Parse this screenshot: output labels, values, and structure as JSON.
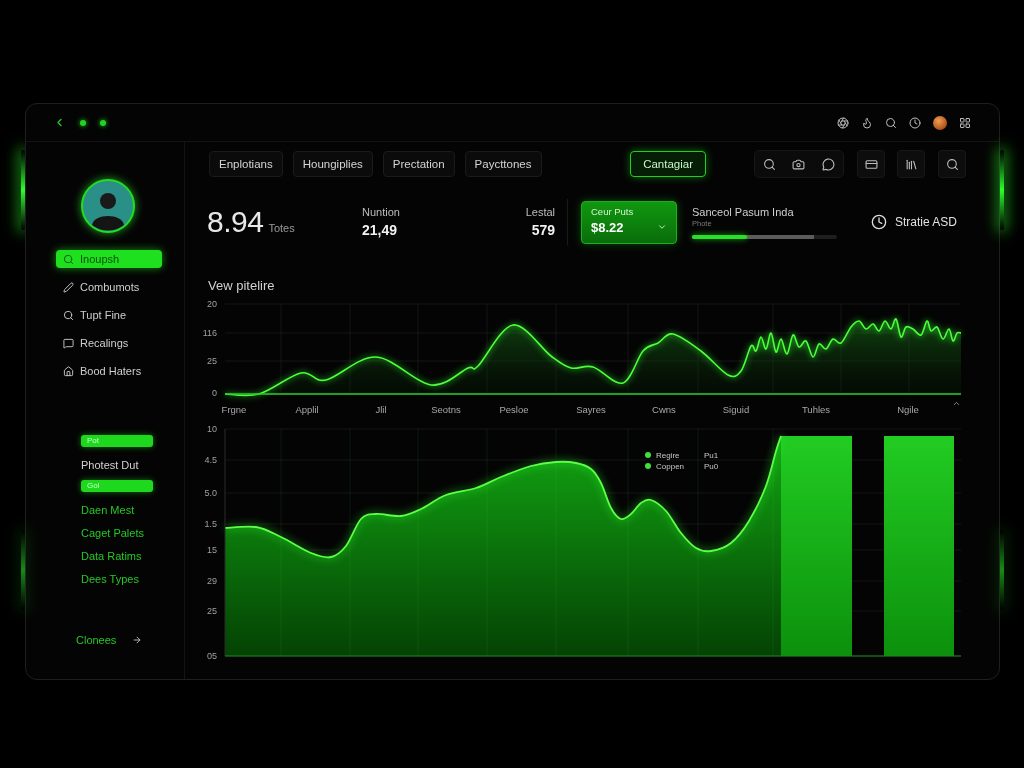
{
  "sidebar": {
    "nav_items": [
      {
        "label": "Inoupsh",
        "selected": true
      },
      {
        "label": "Combumots",
        "selected": false
      },
      {
        "label": "Tupt Fine",
        "selected": false
      },
      {
        "label": "Recalings",
        "selected": false
      },
      {
        "label": "Bood Haters",
        "selected": false
      }
    ],
    "groups": [
      {
        "tag": "Pot",
        "items": [
          {
            "label": "Photest Dut",
            "kind": "text"
          }
        ]
      },
      {
        "tag": "Gol",
        "items": [
          {
            "label": "Daen Mest",
            "kind": "link"
          },
          {
            "label": "Caget Palets",
            "kind": "link"
          },
          {
            "label": "Data Ratims",
            "kind": "link"
          },
          {
            "label": "Dees Types",
            "kind": "link"
          }
        ]
      }
    ],
    "footer_link": "Clonees"
  },
  "header": {
    "nav_buttons": [
      "Enplotians",
      "Houngiplies",
      "Prectation",
      "Paycttones"
    ],
    "action_button": "Cantagiar"
  },
  "stats": {
    "total": {
      "value": "8.94",
      "unit": "Totes"
    },
    "metrics": [
      {
        "label": "Nuntion",
        "value": "21,49"
      },
      {
        "label": "Lestal",
        "value": "579"
      }
    ],
    "card": {
      "label": "Ceur Puts",
      "value": "$8.22"
    },
    "progress": {
      "title": "Sanceol Pasum Inda",
      "subtitle": "Phote",
      "level": 0.38
    },
    "status": "Stratie ASD"
  },
  "line_chart": {
    "title": "Vew pitelire",
    "y_labels": [
      "20",
      "116",
      "25",
      "0"
    ],
    "x_labels": [
      "Frgne",
      "Applil",
      "Jlil",
      "Seotns",
      "Pesloe",
      "Sayres",
      "Cwns",
      "Siguid",
      "Tuhles",
      "Ngile"
    ]
  },
  "area_chart": {
    "y_labels": [
      "10",
      "4.5",
      "5.0",
      "1.5",
      "15",
      "29",
      "25",
      "05"
    ],
    "legend": [
      {
        "label": "Regire",
        "value": "Pu1"
      },
      {
        "label": "Coppen",
        "value": "Pu0"
      }
    ]
  }
}
